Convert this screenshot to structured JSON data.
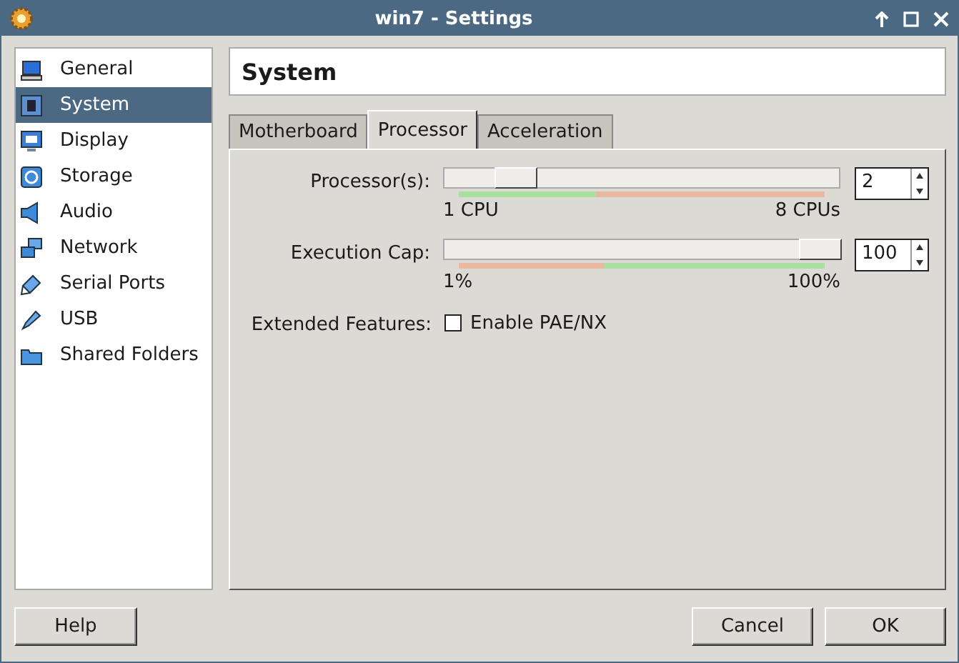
{
  "window": {
    "title": "win7 - Settings"
  },
  "sidebar": {
    "items": [
      {
        "label": "General",
        "selected": false
      },
      {
        "label": "System",
        "selected": true
      },
      {
        "label": "Display",
        "selected": false
      },
      {
        "label": "Storage",
        "selected": false
      },
      {
        "label": "Audio",
        "selected": false
      },
      {
        "label": "Network",
        "selected": false
      },
      {
        "label": "Serial Ports",
        "selected": false
      },
      {
        "label": "USB",
        "selected": false
      },
      {
        "label": "Shared Folders",
        "selected": false
      }
    ]
  },
  "header": {
    "title": "System"
  },
  "tabs": [
    {
      "label": "Motherboard",
      "selected": false
    },
    {
      "label": "Processor",
      "selected": true
    },
    {
      "label": "Acceleration",
      "selected": false
    }
  ],
  "sliders": [
    {
      "label": "Processor(s):",
      "level": 0.14,
      "min_label": "1 CPU",
      "max_label": "8 CPUs",
      "value": "2"
    },
    {
      "label": "Execution Cap:",
      "level": 1.0,
      "min_label": "1%",
      "max_label": "100%",
      "value": "100"
    }
  ],
  "extended_features": {
    "label": "Extended Features:",
    "option": "Enable PAE/NX",
    "checked": false
  },
  "buttons": {
    "help": "Help",
    "cancel": "Cancel",
    "ok": "OK"
  }
}
